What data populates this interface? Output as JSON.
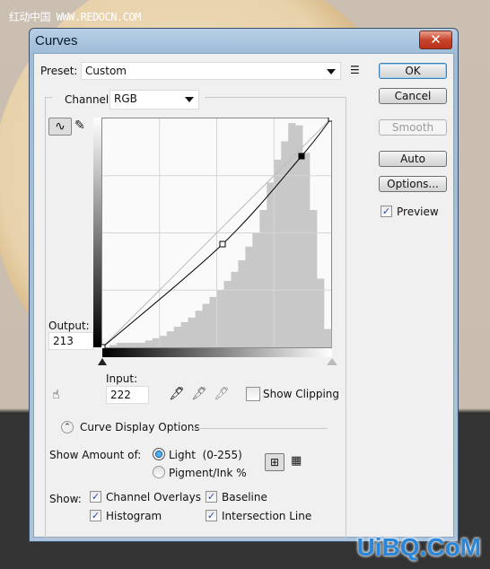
{
  "watermark_top": "红动中国 WWW.REDOCN.COM",
  "watermark_bottom": "UiBQ.CoM",
  "dialog": {
    "title": "Curves",
    "close": "✕"
  },
  "preset": {
    "label": "Preset:",
    "value": "Custom"
  },
  "channel": {
    "label": "Channel:",
    "value": "RGB"
  },
  "buttons": {
    "ok": "OK",
    "cancel": "Cancel",
    "smooth": "Smooth",
    "auto": "Auto",
    "options": "Options..."
  },
  "preview": {
    "label": "Preview",
    "checked": true
  },
  "output": {
    "label": "Output:",
    "value": "213"
  },
  "input": {
    "label": "Input:",
    "value": "222"
  },
  "show_clipping": {
    "label": "Show Clipping",
    "checked": false
  },
  "curve_display_options": "Curve Display Options",
  "show_amount": {
    "label": "Show Amount of:",
    "options": [
      "Light  (0-255)",
      "Pigment/Ink %"
    ],
    "selected": 0
  },
  "show": {
    "label": "Show:",
    "channel_overlays": "Channel Overlays",
    "histogram": "Histogram",
    "baseline": "Baseline",
    "intersection_line": "Intersection Line"
  },
  "chart_data": {
    "type": "line",
    "xlim": [
      0,
      255
    ],
    "ylim": [
      0,
      255
    ],
    "grid": "4x4",
    "curve_points": [
      [
        0,
        0
      ],
      [
        134,
        115
      ],
      [
        222,
        213
      ],
      [
        255,
        255
      ]
    ],
    "selected_point": [
      222,
      213
    ],
    "histogram_bins": [
      0,
      0.01,
      0.02,
      0.02,
      0.02,
      0.02,
      0.03,
      0.04,
      0.05,
      0.07,
      0.09,
      0.11,
      0.13,
      0.16,
      0.19,
      0.22,
      0.25,
      0.29,
      0.33,
      0.38,
      0.44,
      0.5,
      0.6,
      0.72,
      0.82,
      0.9,
      0.98,
      0.97,
      0.85,
      0.6,
      0.3,
      0.08
    ]
  },
  "colors": {
    "histogram": "#c8c8c8",
    "curve": "#000000",
    "accent": "#274e9b"
  }
}
